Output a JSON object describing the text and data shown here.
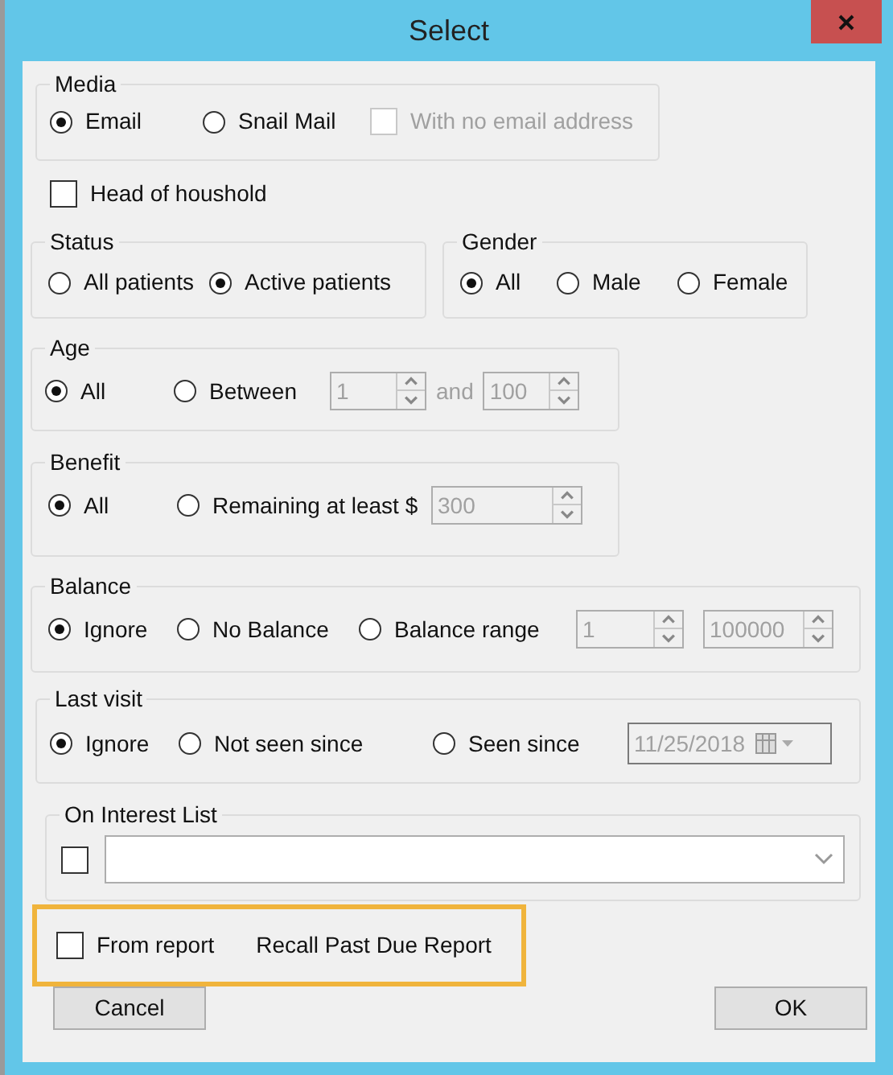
{
  "window": {
    "title": "Select"
  },
  "media": {
    "title": "Media",
    "items": [
      {
        "kind": "radio",
        "label": "Email",
        "selected": true
      },
      {
        "kind": "radio",
        "label": "Snail Mail",
        "selected": false
      },
      {
        "kind": "checkbox",
        "label": "With no email address",
        "checked": false,
        "disabled": true
      }
    ]
  },
  "head_of_household": {
    "label": "Head of houshold",
    "checked": false
  },
  "status": {
    "title": "Status",
    "items": [
      {
        "kind": "radio",
        "label": "All patients",
        "selected": false
      },
      {
        "kind": "radio",
        "label": "Active patients",
        "selected": true
      }
    ]
  },
  "gender": {
    "title": "Gender",
    "items": [
      {
        "kind": "radio",
        "label": "All",
        "selected": true
      },
      {
        "kind": "radio",
        "label": "Male",
        "selected": false
      },
      {
        "kind": "radio",
        "label": "Female",
        "selected": false
      }
    ]
  },
  "age": {
    "title": "Age",
    "items": [
      {
        "kind": "radio",
        "label": "All",
        "selected": true
      },
      {
        "kind": "radio",
        "label": "Between",
        "selected": false
      },
      {
        "kind": "spin",
        "value": "1",
        "disabled": true
      },
      {
        "kind": "text",
        "label": "and",
        "disabled": true
      },
      {
        "kind": "spin",
        "value": "100",
        "disabled": true
      }
    ]
  },
  "benefit": {
    "title": "Benefit",
    "items": [
      {
        "kind": "radio",
        "label": "All",
        "selected": true
      },
      {
        "kind": "radio",
        "label": "Remaining at least $",
        "selected": false
      },
      {
        "kind": "spin",
        "value": "300",
        "disabled": true
      }
    ]
  },
  "balance": {
    "title": "Balance",
    "items": [
      {
        "kind": "radio",
        "label": "Ignore",
        "selected": true
      },
      {
        "kind": "radio",
        "label": "No Balance",
        "selected": false
      },
      {
        "kind": "radio",
        "label": "Balance range",
        "selected": false
      },
      {
        "kind": "spin",
        "value": "1",
        "disabled": true
      },
      {
        "kind": "spin",
        "value": "100000",
        "disabled": true
      }
    ]
  },
  "last_visit": {
    "title": "Last visit",
    "items": [
      {
        "kind": "radio",
        "label": "Ignore",
        "selected": true
      },
      {
        "kind": "radio",
        "label": "Not seen since",
        "selected": false
      },
      {
        "kind": "radio",
        "label": "Seen since",
        "selected": false
      },
      {
        "kind": "date",
        "value": "11/25/2018",
        "disabled": true
      }
    ]
  },
  "interest_list": {
    "title": "On Interest List",
    "items": [
      {
        "kind": "checkbox",
        "checked": false,
        "disabled": false
      },
      {
        "kind": "combo"
      }
    ]
  },
  "from_report": {
    "label": "From report",
    "checked": false,
    "report": "Recall Past Due Report"
  },
  "buttons": [
    "Cancel",
    "OK"
  ]
}
